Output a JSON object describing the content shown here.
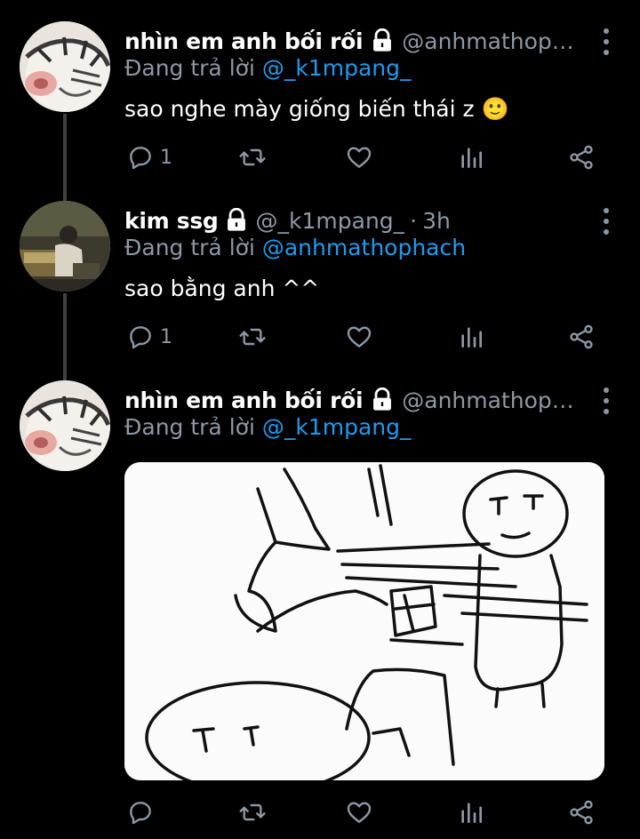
{
  "tweets": [
    {
      "name": "nhìn em anh bối rối",
      "handle": "@anhmathopha...",
      "time": "",
      "reply_prefix": "Đang trả lời ",
      "reply_to": "@_k1mpang_",
      "text": "sao nghe mày giống biến thái z 🙂",
      "replies": "1",
      "retweets": "",
      "likes": ""
    },
    {
      "name": "kim ssg",
      "handle": "@_k1mpang_",
      "dot": "·",
      "time": "3h",
      "reply_prefix": "Đang trả lời ",
      "reply_to": "@anhmathophach",
      "text": "sao bằng anh ^^",
      "replies": "1",
      "retweets": "",
      "likes": ""
    },
    {
      "name": "nhìn em anh bối rối",
      "handle": "@anhmathopha...",
      "time": "",
      "reply_prefix": "Đang trả lời ",
      "reply_to": "@_k1mpang_",
      "text": "",
      "media": "sketch-image",
      "replies": "",
      "retweets": "",
      "likes": ""
    }
  ],
  "icons": {
    "reply": "reply-icon",
    "retweet": "retweet-icon",
    "like": "heart-icon",
    "views": "analytics-icon",
    "share": "share-icon",
    "lock": "lock-icon",
    "more": "more-vertical-icon"
  },
  "colors": {
    "background": "#000000",
    "text": "#ffffff",
    "secondary": "#8b98a5",
    "link": "#1d9bf0",
    "thread_line": "#3e4144"
  }
}
